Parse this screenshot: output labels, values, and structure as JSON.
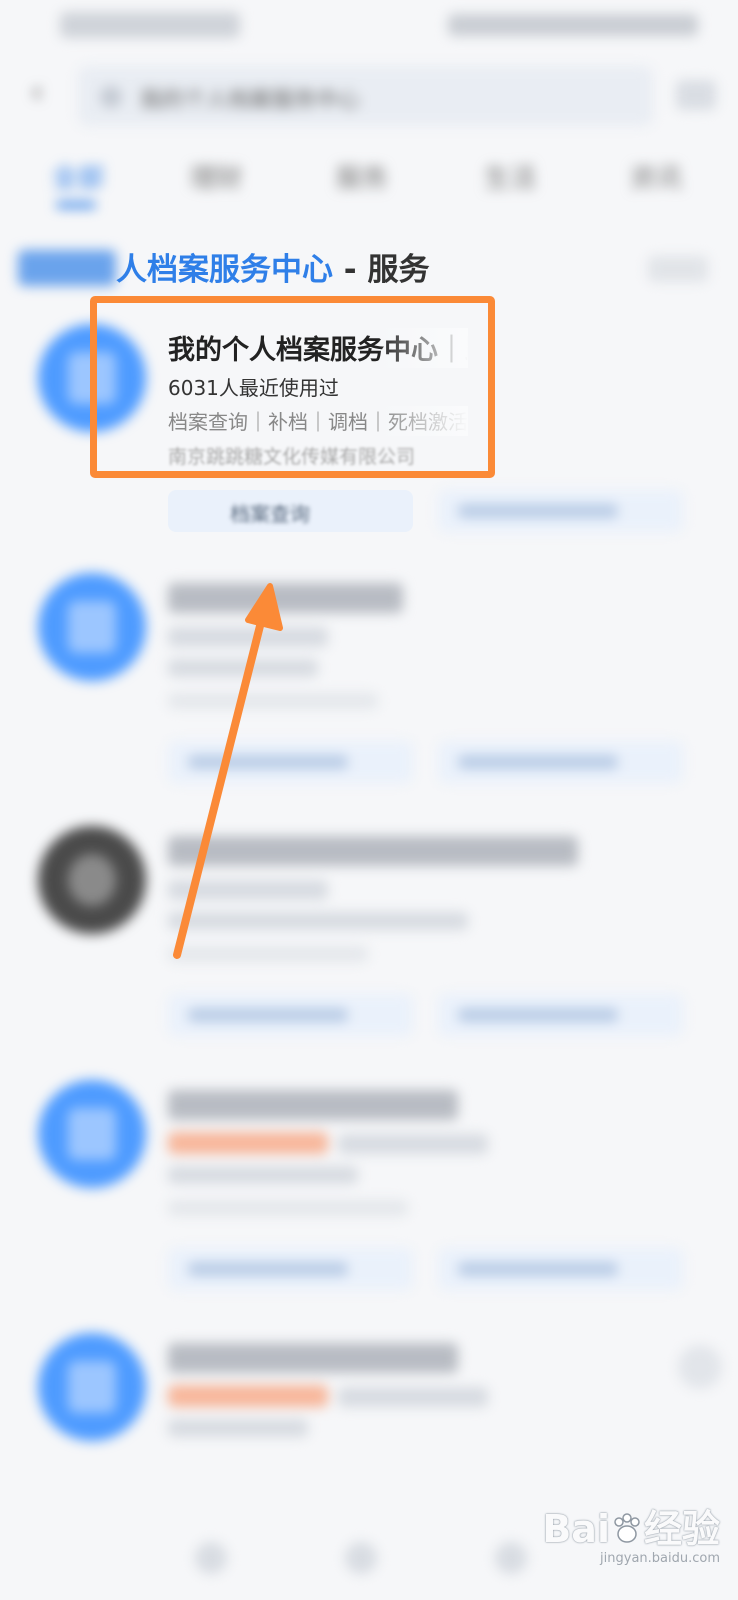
{
  "search": {
    "query_text": "我的个人档案服务中心"
  },
  "tabs": [
    {
      "label": "全部"
    },
    {
      "label": "理财"
    },
    {
      "label": "服务"
    },
    {
      "label": "生活"
    },
    {
      "label": "资讯"
    }
  ],
  "section": {
    "title_highlight": "人档案服务中心",
    "title_suffix": " - 服务"
  },
  "first_result": {
    "title": "我的个人档案服务中心｜跳跳糖",
    "usage": "6031人最近使用过",
    "tags": "档案查询｜补档｜调档｜死档激活",
    "company": "南京跳跳糖文化传媒有限公司",
    "action_primary": "档案查询"
  },
  "watermark": {
    "brand_left": "Bai",
    "brand_right": "经验",
    "url": "jingyan.baidu.com"
  },
  "colors": {
    "accent_blue": "#2f7fe8",
    "highlight_orange": "#fb8a37",
    "avatar_blue": "#4e9bff"
  }
}
